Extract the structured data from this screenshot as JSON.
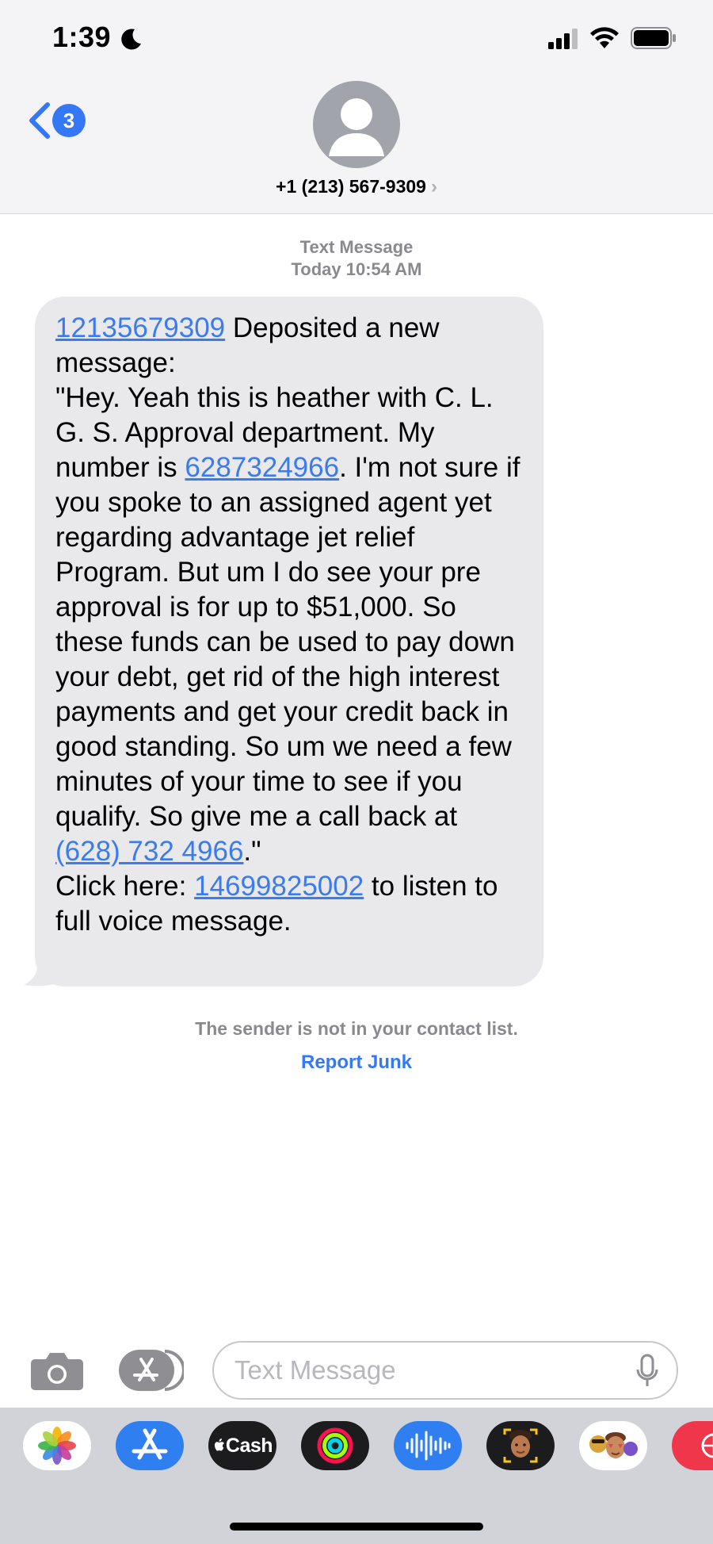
{
  "status_bar": {
    "time": "1:39"
  },
  "nav": {
    "back_badge": "3",
    "contact": "+1 (213) 567-9309",
    "chevron": "›"
  },
  "timestamp": {
    "label": "Text Message",
    "time": "Today 10:54 AM"
  },
  "message": {
    "link1": "12135679309",
    "text1": " Deposited a new message:",
    "text2": "\"Hey. Yeah this is heather with C. L. G. S. Approval department. My number is ",
    "link2": "6287324966",
    "text3": ". I'm not sure if you spoke to an assigned agent yet regarding advantage jet relief Program. But um I do see your pre approval is for up to $51,000. So these funds can be used to pay down your debt, get rid of the high interest payments and get your credit back in good standing. So um we need a few minutes of your time to see if you qualify. So give me a call back at ",
    "link3": "(628) 732 4966",
    "text4": ".\"",
    "text5": "Click here: ",
    "link4": "14699825002",
    "text6": " to listen to full voice message."
  },
  "notice": {
    "text": "The sender is not in your contact list.",
    "report_label": "Report Junk"
  },
  "compose": {
    "placeholder": "Text Message"
  },
  "apps": {
    "cash_label": "Cash"
  },
  "colors": {
    "accent": "#3478f6",
    "link": "#3a7bf0",
    "bubble": "#e9e9eb"
  }
}
